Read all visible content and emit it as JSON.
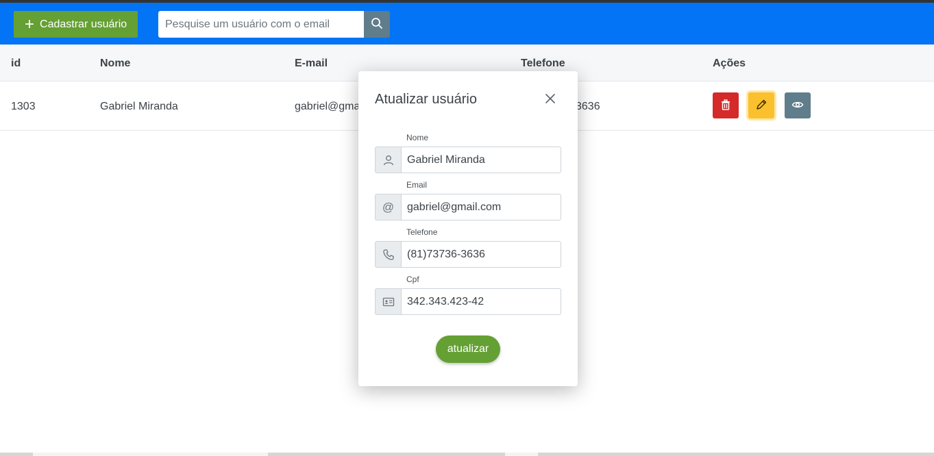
{
  "navbar": {
    "add_user_label": "Cadastrar usuário",
    "search_placeholder": "Pesquise um usuário com o email",
    "search_value": ""
  },
  "table": {
    "columns": [
      "id",
      "Nome",
      "E-mail",
      "Telefone",
      "Ações"
    ],
    "rows": [
      {
        "id": "1303",
        "nome": "Gabriel Miranda",
        "email": "gabriel@gma",
        "telefone": "3636"
      }
    ]
  },
  "modal": {
    "title": "Atualizar usuário",
    "fields": [
      {
        "label": "Nome",
        "value": "Gabriel Miranda",
        "icon": "user-icon"
      },
      {
        "label": "Email",
        "value": "gabriel@gmail.com",
        "icon": "at-icon"
      },
      {
        "label": "Telefone",
        "value": "(81)73736-3636",
        "icon": "phone-icon"
      },
      {
        "label": "Cpf",
        "value": "342.343.423-42",
        "icon": "id-card-icon"
      }
    ],
    "submit_label": "atualizar"
  },
  "colors": {
    "navbar": "#0374f5",
    "primary_green": "#64a033",
    "danger": "#d42a2a",
    "warning": "#fbc02d",
    "secondary": "#607d8b"
  }
}
